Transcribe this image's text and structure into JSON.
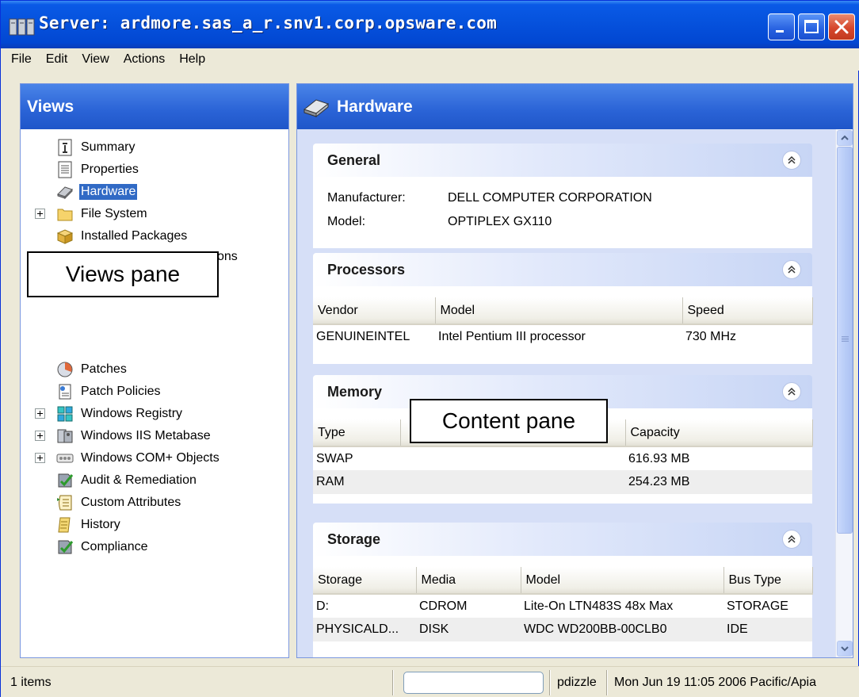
{
  "window": {
    "title": "Server: ardmore.sas_a_r.snv1.corp.opsware.com",
    "icon": "server-icon"
  },
  "menu": [
    "File",
    "Edit",
    "View",
    "Actions",
    "Help"
  ],
  "views": {
    "title": "Views",
    "items": [
      {
        "label": "Summary",
        "icon": "summary-icon",
        "expandable": false
      },
      {
        "label": "Properties",
        "icon": "properties-icon",
        "expandable": false
      },
      {
        "label": "Hardware",
        "icon": "hardware-icon",
        "expandable": false,
        "selected": true
      },
      {
        "label": "File System",
        "icon": "folder-icon",
        "expandable": true
      },
      {
        "label": "Installed Packages",
        "icon": "package-icon",
        "expandable": false
      },
      {
        "label": "Patches",
        "icon": "patch-icon",
        "expandable": false
      },
      {
        "label": "Patch Policies",
        "icon": "patch-policy-icon",
        "expandable": false
      },
      {
        "label": "Windows Registry",
        "icon": "registry-icon",
        "expandable": true
      },
      {
        "label": "Windows IIS Metabase",
        "icon": "iis-icon",
        "expandable": true
      },
      {
        "label": "Windows COM+ Objects",
        "icon": "com-icon",
        "expandable": true
      },
      {
        "label": "Audit & Remediation",
        "icon": "audit-icon",
        "expandable": false
      },
      {
        "label": "Custom Attributes",
        "icon": "attributes-icon",
        "expandable": false
      },
      {
        "label": "History",
        "icon": "history-icon",
        "expandable": false
      },
      {
        "label": "Compliance",
        "icon": "compliance-icon",
        "expandable": false
      }
    ],
    "partial_label": "ons",
    "callout": "Views pane"
  },
  "content": {
    "title": "Hardware",
    "callout": "Content pane",
    "general": {
      "title": "General",
      "rows": [
        {
          "key": "Manufacturer:",
          "value": "DELL COMPUTER CORPORATION"
        },
        {
          "key": "Model:",
          "value": "OPTIPLEX GX110"
        }
      ]
    },
    "processors": {
      "title": "Processors",
      "columns": [
        "Vendor",
        "Model",
        "Speed"
      ],
      "rows": [
        [
          "GENUINEINTEL",
          "Intel Pentium III processor",
          "730 MHz"
        ]
      ]
    },
    "memory": {
      "title": "Memory",
      "columns": [
        "Type",
        "",
        "Capacity"
      ],
      "rows": [
        [
          "SWAP",
          "",
          "616.93 MB"
        ],
        [
          "RAM",
          "",
          "254.23 MB"
        ]
      ]
    },
    "storage": {
      "title": "Storage",
      "columns": [
        "Storage",
        "Media",
        "Model",
        "Bus Type"
      ],
      "rows": [
        [
          "D:",
          "CDROM",
          "Lite-On LTN483S 48x Max",
          "STORAGE"
        ],
        [
          "PHYSICALD...",
          "DISK",
          "WDC WD200BB-00CLB0",
          "IDE"
        ]
      ]
    }
  },
  "status": {
    "count": "1 items",
    "user": "pdizzle",
    "datetime": "Mon Jun 19 11:05 2006 Pacific/Apia"
  }
}
